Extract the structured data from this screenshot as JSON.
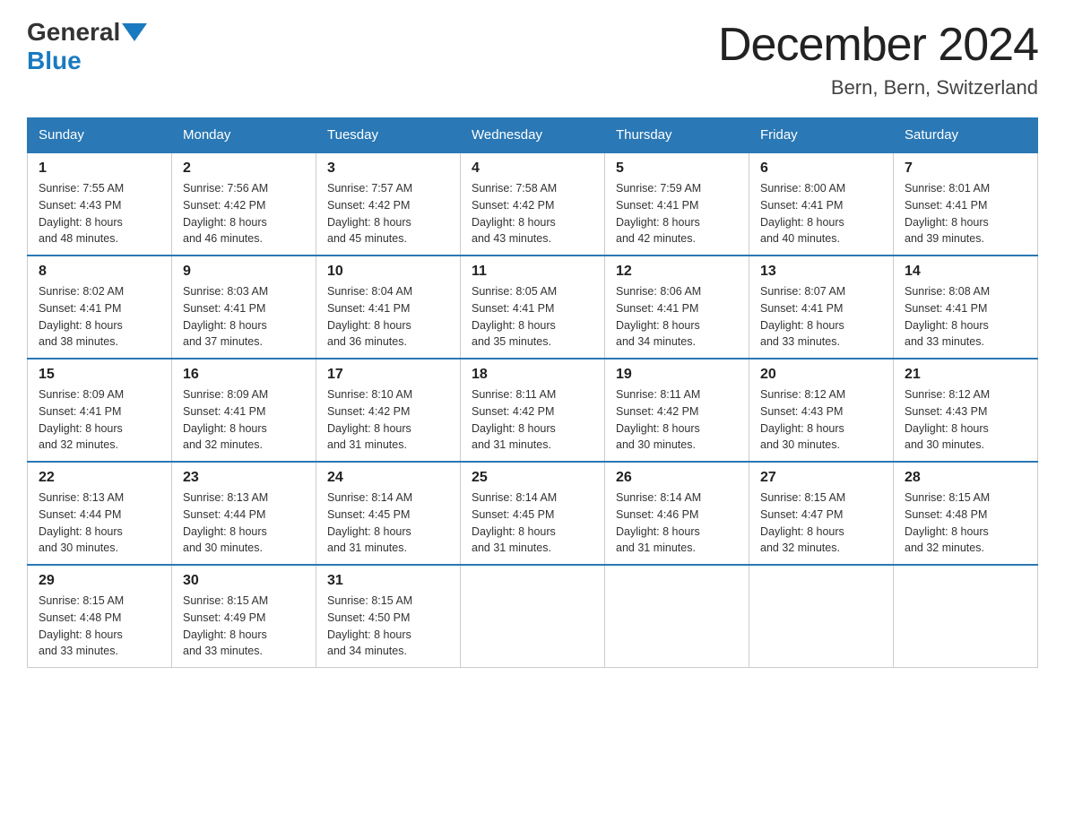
{
  "header": {
    "logo_general": "General",
    "logo_blue": "Blue",
    "month_title": "December 2024",
    "location": "Bern, Bern, Switzerland"
  },
  "days_of_week": [
    "Sunday",
    "Monday",
    "Tuesday",
    "Wednesday",
    "Thursday",
    "Friday",
    "Saturday"
  ],
  "weeks": [
    [
      {
        "day": "1",
        "sunrise": "7:55 AM",
        "sunset": "4:43 PM",
        "daylight": "8 hours and 48 minutes."
      },
      {
        "day": "2",
        "sunrise": "7:56 AM",
        "sunset": "4:42 PM",
        "daylight": "8 hours and 46 minutes."
      },
      {
        "day": "3",
        "sunrise": "7:57 AM",
        "sunset": "4:42 PM",
        "daylight": "8 hours and 45 minutes."
      },
      {
        "day": "4",
        "sunrise": "7:58 AM",
        "sunset": "4:42 PM",
        "daylight": "8 hours and 43 minutes."
      },
      {
        "day": "5",
        "sunrise": "7:59 AM",
        "sunset": "4:41 PM",
        "daylight": "8 hours and 42 minutes."
      },
      {
        "day": "6",
        "sunrise": "8:00 AM",
        "sunset": "4:41 PM",
        "daylight": "8 hours and 40 minutes."
      },
      {
        "day": "7",
        "sunrise": "8:01 AM",
        "sunset": "4:41 PM",
        "daylight": "8 hours and 39 minutes."
      }
    ],
    [
      {
        "day": "8",
        "sunrise": "8:02 AM",
        "sunset": "4:41 PM",
        "daylight": "8 hours and 38 minutes."
      },
      {
        "day": "9",
        "sunrise": "8:03 AM",
        "sunset": "4:41 PM",
        "daylight": "8 hours and 37 minutes."
      },
      {
        "day": "10",
        "sunrise": "8:04 AM",
        "sunset": "4:41 PM",
        "daylight": "8 hours and 36 minutes."
      },
      {
        "day": "11",
        "sunrise": "8:05 AM",
        "sunset": "4:41 PM",
        "daylight": "8 hours and 35 minutes."
      },
      {
        "day": "12",
        "sunrise": "8:06 AM",
        "sunset": "4:41 PM",
        "daylight": "8 hours and 34 minutes."
      },
      {
        "day": "13",
        "sunrise": "8:07 AM",
        "sunset": "4:41 PM",
        "daylight": "8 hours and 33 minutes."
      },
      {
        "day": "14",
        "sunrise": "8:08 AM",
        "sunset": "4:41 PM",
        "daylight": "8 hours and 33 minutes."
      }
    ],
    [
      {
        "day": "15",
        "sunrise": "8:09 AM",
        "sunset": "4:41 PM",
        "daylight": "8 hours and 32 minutes."
      },
      {
        "day": "16",
        "sunrise": "8:09 AM",
        "sunset": "4:41 PM",
        "daylight": "8 hours and 32 minutes."
      },
      {
        "day": "17",
        "sunrise": "8:10 AM",
        "sunset": "4:42 PM",
        "daylight": "8 hours and 31 minutes."
      },
      {
        "day": "18",
        "sunrise": "8:11 AM",
        "sunset": "4:42 PM",
        "daylight": "8 hours and 31 minutes."
      },
      {
        "day": "19",
        "sunrise": "8:11 AM",
        "sunset": "4:42 PM",
        "daylight": "8 hours and 30 minutes."
      },
      {
        "day": "20",
        "sunrise": "8:12 AM",
        "sunset": "4:43 PM",
        "daylight": "8 hours and 30 minutes."
      },
      {
        "day": "21",
        "sunrise": "8:12 AM",
        "sunset": "4:43 PM",
        "daylight": "8 hours and 30 minutes."
      }
    ],
    [
      {
        "day": "22",
        "sunrise": "8:13 AM",
        "sunset": "4:44 PM",
        "daylight": "8 hours and 30 minutes."
      },
      {
        "day": "23",
        "sunrise": "8:13 AM",
        "sunset": "4:44 PM",
        "daylight": "8 hours and 30 minutes."
      },
      {
        "day": "24",
        "sunrise": "8:14 AM",
        "sunset": "4:45 PM",
        "daylight": "8 hours and 31 minutes."
      },
      {
        "day": "25",
        "sunrise": "8:14 AM",
        "sunset": "4:45 PM",
        "daylight": "8 hours and 31 minutes."
      },
      {
        "day": "26",
        "sunrise": "8:14 AM",
        "sunset": "4:46 PM",
        "daylight": "8 hours and 31 minutes."
      },
      {
        "day": "27",
        "sunrise": "8:15 AM",
        "sunset": "4:47 PM",
        "daylight": "8 hours and 32 minutes."
      },
      {
        "day": "28",
        "sunrise": "8:15 AM",
        "sunset": "4:48 PM",
        "daylight": "8 hours and 32 minutes."
      }
    ],
    [
      {
        "day": "29",
        "sunrise": "8:15 AM",
        "sunset": "4:48 PM",
        "daylight": "8 hours and 33 minutes."
      },
      {
        "day": "30",
        "sunrise": "8:15 AM",
        "sunset": "4:49 PM",
        "daylight": "8 hours and 33 minutes."
      },
      {
        "day": "31",
        "sunrise": "8:15 AM",
        "sunset": "4:50 PM",
        "daylight": "8 hours and 34 minutes."
      },
      null,
      null,
      null,
      null
    ]
  ],
  "labels": {
    "sunrise": "Sunrise:",
    "sunset": "Sunset:",
    "daylight": "Daylight:"
  }
}
